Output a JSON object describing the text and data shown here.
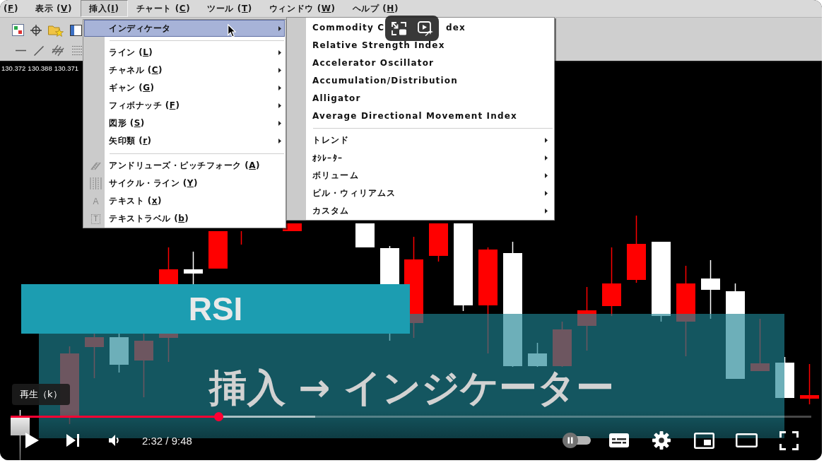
{
  "app_window": {
    "menu_bar": [
      {
        "label": "(",
        "mnemonic": "F",
        "label_end": ")",
        "selected": false
      },
      {
        "label": "表示 (",
        "mnemonic": "V",
        "label_end": ")",
        "selected": false
      },
      {
        "label": "挿入(",
        "mnemonic": "I",
        "label_end": ")",
        "selected": true
      },
      {
        "label": "チャート (",
        "mnemonic": "C",
        "label_end": ")",
        "selected": false
      },
      {
        "label": "ツール (",
        "mnemonic": "T",
        "label_end": ")",
        "selected": false
      },
      {
        "label": "ウィンドウ (",
        "mnemonic": "W",
        "label_end": ")",
        "selected": false
      },
      {
        "label": "ヘルプ (",
        "mnemonic": "H",
        "label_end": ")",
        "selected": false
      }
    ],
    "price_labels": [
      "130.372",
      "130.388",
      "130.371"
    ],
    "insert_menu": [
      {
        "kind": "submenu",
        "label": "インディケータ",
        "selected": true
      },
      {
        "kind": "separator"
      },
      {
        "kind": "submenu",
        "label": "ライン (",
        "mnemonic": "L",
        "label_end": ")",
        "selected": false
      },
      {
        "kind": "submenu",
        "label": "チャネル (",
        "mnemonic": "C",
        "label_end": ")",
        "selected": false
      },
      {
        "kind": "submenu",
        "label": "ギャン (",
        "mnemonic": "G",
        "label_end": ")",
        "selected": false
      },
      {
        "kind": "submenu",
        "label": "フィボナッチ (",
        "mnemonic": "F",
        "label_end": ")",
        "selected": false
      },
      {
        "kind": "submenu",
        "label": "図形 (",
        "mnemonic": "S",
        "label_end": ")",
        "selected": false
      },
      {
        "kind": "submenu",
        "label": "矢印類 (",
        "mnemonic": "r",
        "label_end": ")",
        "selected": false
      },
      {
        "kind": "separator"
      },
      {
        "kind": "pitchfork",
        "label": "アンドリューズ・ピッチフォーク (",
        "mnemonic": "A",
        "label_end": ")",
        "selected": false
      },
      {
        "kind": "cycles",
        "label": "サイクル・ライン (",
        "mnemonic": "Y",
        "label_end": ")",
        "selected": false
      },
      {
        "kind": "text",
        "glyph": "A",
        "label": "テキスト (",
        "mnemonic": "x",
        "label_end": ")",
        "selected": false
      },
      {
        "kind": "label",
        "glyph": "T",
        "label": "テキストラベル (",
        "mnemonic": "b",
        "label_end": ")",
        "selected": false
      }
    ],
    "indicator_menu": [
      {
        "kind": "indicator",
        "label": "Commodity C",
        "label_after_overlay": "dex",
        "selected": false
      },
      {
        "kind": "indicator",
        "label": "Relative Strength Index",
        "selected": false
      },
      {
        "kind": "indicator",
        "label": "Accelerator Oscillator",
        "selected": false
      },
      {
        "kind": "indicator",
        "label": "Accumulation/Distribution",
        "selected": false
      },
      {
        "kind": "indicator",
        "label": "Alligator",
        "selected": false
      },
      {
        "kind": "indicator",
        "label": "Average Directional Movement Index",
        "selected": false
      },
      {
        "kind": "separator"
      },
      {
        "kind": "submenu",
        "label": "トレンド",
        "selected": false
      },
      {
        "kind": "submenu",
        "label": "ｵｼﾚｰﾀｰ",
        "selected": false
      },
      {
        "kind": "submenu",
        "label": "ボリューム",
        "selected": false
      },
      {
        "kind": "submenu",
        "label": "ビル・ウィリアムス",
        "selected": false
      },
      {
        "kind": "submenu",
        "label": "カスタム",
        "selected": false
      }
    ]
  },
  "video_overlay": {
    "banner": "RSI",
    "caption": "挿入 → インジケーター"
  },
  "player": {
    "tooltip": "再生（k）",
    "playing": false,
    "progress": {
      "level": 0.26,
      "buffer": {
        "level": 0.38
      }
    },
    "time": "2:32 / 9:48",
    "autoplay": {
      "on": false
    }
  }
}
